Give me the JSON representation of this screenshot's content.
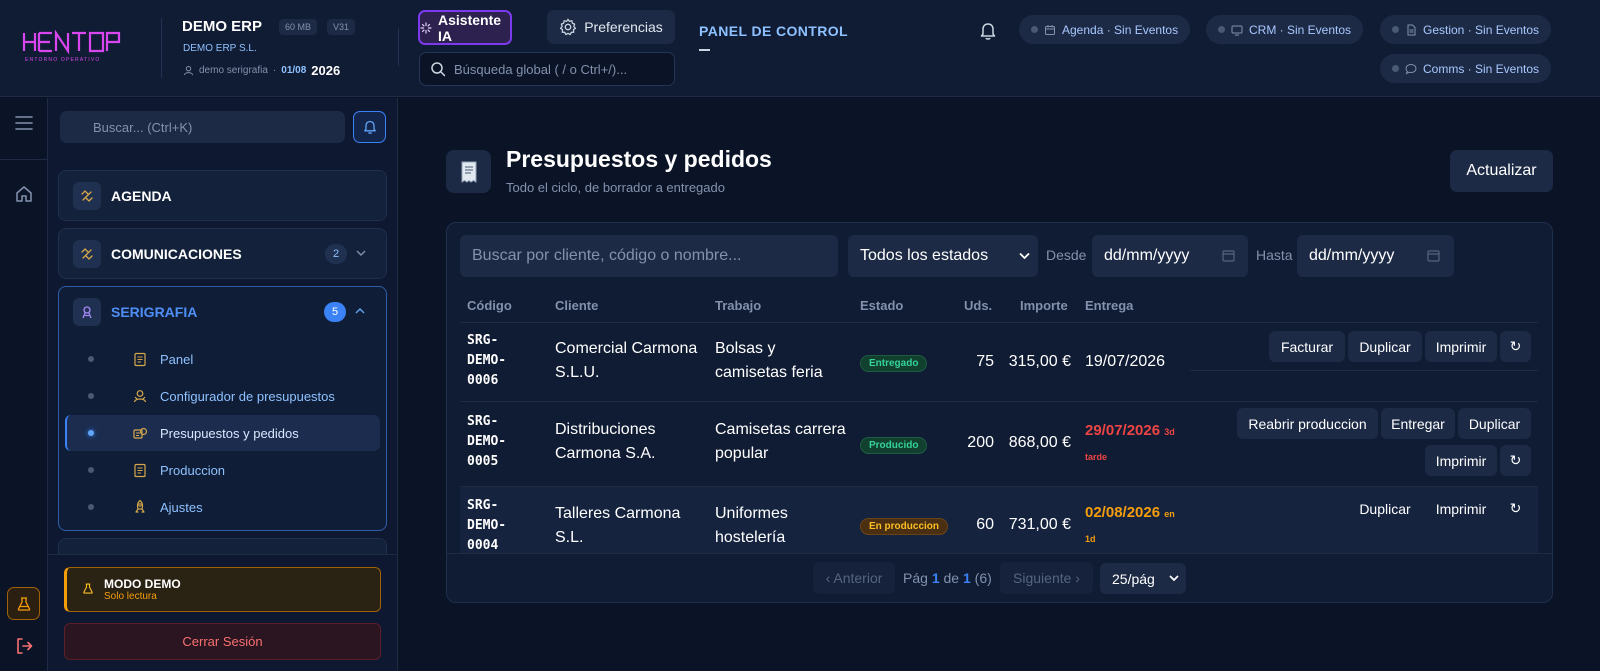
{
  "app": {
    "logo_text": "HENTOP",
    "logo_tagline": "ENTORNO OPERATIVO",
    "company": "DEMO ERP",
    "size_badge": "60 MB",
    "version_badge": "V31",
    "company_legal": "DEMO ERP S.L.",
    "user": "demo serigrafia",
    "separator": "·",
    "date": "01/08",
    "year": "2026"
  },
  "header": {
    "ai_button": "Asistente IA",
    "pref_button": "Preferencias",
    "search_placeholder": "Búsqueda global ( / o Ctrl+/)...",
    "panel_title": "PANEL DE CONTROL",
    "events": [
      {
        "label": "Agenda · Sin Eventos",
        "icon": "calendar-icon"
      },
      {
        "label": "CRM · Sin Eventos",
        "icon": "monitor-icon"
      },
      {
        "label": "Gestion · Sin Eventos",
        "icon": "document-icon"
      },
      {
        "label": "Comms · Sin Eventos",
        "icon": "chat-icon"
      }
    ]
  },
  "sidebar": {
    "search_placeholder": "Buscar... (Ctrl+K)",
    "groups": [
      {
        "title": "AGENDA"
      },
      {
        "title": "COMUNICACIONES",
        "badge": "2"
      },
      {
        "title": "SERIGRAFIA",
        "badge": "5"
      }
    ],
    "items": [
      {
        "label": "Panel"
      },
      {
        "label": "Configurador de presupuestos"
      },
      {
        "label": "Presupuestos y pedidos"
      },
      {
        "label": "Produccion"
      },
      {
        "label": "Ajustes"
      }
    ],
    "demo_title": "MODO DEMO",
    "demo_sub": "Solo lectura",
    "logout": "Cerrar Sesión"
  },
  "main": {
    "title": "Presupuestos y pedidos",
    "subtitle": "Todo el ciclo, de borrador a entregado",
    "refresh": "Actualizar",
    "filters": {
      "search_placeholder": "Buscar por cliente, código o nombre...",
      "status_value": "Todos los estados",
      "from_label": "Desde",
      "to_label": "Hasta",
      "date_placeholder": "dd/mm/yyyy"
    },
    "columns": [
      "Código",
      "Cliente",
      "Trabajo",
      "Estado",
      "Uds.",
      "Importe",
      "Entrega"
    ],
    "rows": [
      {
        "code": [
          "SRG-",
          "DEMO-",
          "0006"
        ],
        "client": [
          "Comercial Carmona",
          "S.L.U."
        ],
        "job": [
          "Bolsas y",
          "camisetas feria"
        ],
        "status": "Entregado",
        "units": "75",
        "amount": "315,00 €",
        "delivery": "19/07/2026",
        "actions": [
          "Facturar",
          "Duplicar",
          "Imprimir",
          "↻"
        ]
      },
      {
        "code": [
          "SRG-",
          "DEMO-",
          "0005"
        ],
        "client": [
          "Distribuciones",
          "Carmona S.A."
        ],
        "job": [
          "Camisetas carrera",
          "popular"
        ],
        "status": "Producido",
        "units": "200",
        "amount": "868,00 €",
        "delivery": "29/07/2026",
        "delivery_tag_1": "3d",
        "delivery_tag_2": "tarde",
        "actions": [
          "Reabrir produccion",
          "Entregar",
          "Duplicar",
          "Imprimir",
          "↻"
        ]
      },
      {
        "code": [
          "SRG-",
          "DEMO-",
          "0004"
        ],
        "client": [
          "Talleres Carmona",
          "S.L."
        ],
        "job": [
          "Uniformes",
          "hostelería"
        ],
        "status": "En produccion",
        "units": "60",
        "amount": "731,00 €",
        "delivery": "02/08/2026",
        "delivery_tag_1": "en",
        "delivery_tag_2": "1d",
        "actions": [
          "Duplicar",
          "Imprimir",
          "↻"
        ]
      }
    ],
    "pager": {
      "prev": "‹ Anterior",
      "page_word": "Pág",
      "page": "1",
      "of_word": "de",
      "total_pages": "1",
      "count": "(6)",
      "next": "Siguiente ›",
      "per_page": "25/pág"
    }
  },
  "colors": {
    "accent": "#3b82f6",
    "logo": "#d946ef",
    "late": "#ef4444",
    "soon": "#f59e0b",
    "delivered": "#34d399"
  }
}
